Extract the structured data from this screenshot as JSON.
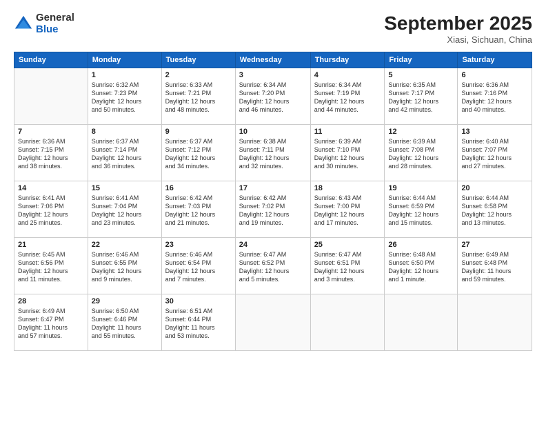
{
  "header": {
    "logo_general": "General",
    "logo_blue": "Blue",
    "month": "September 2025",
    "location": "Xiasi, Sichuan, China"
  },
  "weekdays": [
    "Sunday",
    "Monday",
    "Tuesday",
    "Wednesday",
    "Thursday",
    "Friday",
    "Saturday"
  ],
  "weeks": [
    [
      {
        "day": "",
        "info": ""
      },
      {
        "day": "1",
        "info": "Sunrise: 6:32 AM\nSunset: 7:23 PM\nDaylight: 12 hours\nand 50 minutes."
      },
      {
        "day": "2",
        "info": "Sunrise: 6:33 AM\nSunset: 7:21 PM\nDaylight: 12 hours\nand 48 minutes."
      },
      {
        "day": "3",
        "info": "Sunrise: 6:34 AM\nSunset: 7:20 PM\nDaylight: 12 hours\nand 46 minutes."
      },
      {
        "day": "4",
        "info": "Sunrise: 6:34 AM\nSunset: 7:19 PM\nDaylight: 12 hours\nand 44 minutes."
      },
      {
        "day": "5",
        "info": "Sunrise: 6:35 AM\nSunset: 7:17 PM\nDaylight: 12 hours\nand 42 minutes."
      },
      {
        "day": "6",
        "info": "Sunrise: 6:36 AM\nSunset: 7:16 PM\nDaylight: 12 hours\nand 40 minutes."
      }
    ],
    [
      {
        "day": "7",
        "info": "Sunrise: 6:36 AM\nSunset: 7:15 PM\nDaylight: 12 hours\nand 38 minutes."
      },
      {
        "day": "8",
        "info": "Sunrise: 6:37 AM\nSunset: 7:14 PM\nDaylight: 12 hours\nand 36 minutes."
      },
      {
        "day": "9",
        "info": "Sunrise: 6:37 AM\nSunset: 7:12 PM\nDaylight: 12 hours\nand 34 minutes."
      },
      {
        "day": "10",
        "info": "Sunrise: 6:38 AM\nSunset: 7:11 PM\nDaylight: 12 hours\nand 32 minutes."
      },
      {
        "day": "11",
        "info": "Sunrise: 6:39 AM\nSunset: 7:10 PM\nDaylight: 12 hours\nand 30 minutes."
      },
      {
        "day": "12",
        "info": "Sunrise: 6:39 AM\nSunset: 7:08 PM\nDaylight: 12 hours\nand 28 minutes."
      },
      {
        "day": "13",
        "info": "Sunrise: 6:40 AM\nSunset: 7:07 PM\nDaylight: 12 hours\nand 27 minutes."
      }
    ],
    [
      {
        "day": "14",
        "info": "Sunrise: 6:41 AM\nSunset: 7:06 PM\nDaylight: 12 hours\nand 25 minutes."
      },
      {
        "day": "15",
        "info": "Sunrise: 6:41 AM\nSunset: 7:04 PM\nDaylight: 12 hours\nand 23 minutes."
      },
      {
        "day": "16",
        "info": "Sunrise: 6:42 AM\nSunset: 7:03 PM\nDaylight: 12 hours\nand 21 minutes."
      },
      {
        "day": "17",
        "info": "Sunrise: 6:42 AM\nSunset: 7:02 PM\nDaylight: 12 hours\nand 19 minutes."
      },
      {
        "day": "18",
        "info": "Sunrise: 6:43 AM\nSunset: 7:00 PM\nDaylight: 12 hours\nand 17 minutes."
      },
      {
        "day": "19",
        "info": "Sunrise: 6:44 AM\nSunset: 6:59 PM\nDaylight: 12 hours\nand 15 minutes."
      },
      {
        "day": "20",
        "info": "Sunrise: 6:44 AM\nSunset: 6:58 PM\nDaylight: 12 hours\nand 13 minutes."
      }
    ],
    [
      {
        "day": "21",
        "info": "Sunrise: 6:45 AM\nSunset: 6:56 PM\nDaylight: 12 hours\nand 11 minutes."
      },
      {
        "day": "22",
        "info": "Sunrise: 6:46 AM\nSunset: 6:55 PM\nDaylight: 12 hours\nand 9 minutes."
      },
      {
        "day": "23",
        "info": "Sunrise: 6:46 AM\nSunset: 6:54 PM\nDaylight: 12 hours\nand 7 minutes."
      },
      {
        "day": "24",
        "info": "Sunrise: 6:47 AM\nSunset: 6:52 PM\nDaylight: 12 hours\nand 5 minutes."
      },
      {
        "day": "25",
        "info": "Sunrise: 6:47 AM\nSunset: 6:51 PM\nDaylight: 12 hours\nand 3 minutes."
      },
      {
        "day": "26",
        "info": "Sunrise: 6:48 AM\nSunset: 6:50 PM\nDaylight: 12 hours\nand 1 minute."
      },
      {
        "day": "27",
        "info": "Sunrise: 6:49 AM\nSunset: 6:48 PM\nDaylight: 11 hours\nand 59 minutes."
      }
    ],
    [
      {
        "day": "28",
        "info": "Sunrise: 6:49 AM\nSunset: 6:47 PM\nDaylight: 11 hours\nand 57 minutes."
      },
      {
        "day": "29",
        "info": "Sunrise: 6:50 AM\nSunset: 6:46 PM\nDaylight: 11 hours\nand 55 minutes."
      },
      {
        "day": "30",
        "info": "Sunrise: 6:51 AM\nSunset: 6:44 PM\nDaylight: 11 hours\nand 53 minutes."
      },
      {
        "day": "",
        "info": ""
      },
      {
        "day": "",
        "info": ""
      },
      {
        "day": "",
        "info": ""
      },
      {
        "day": "",
        "info": ""
      }
    ]
  ]
}
